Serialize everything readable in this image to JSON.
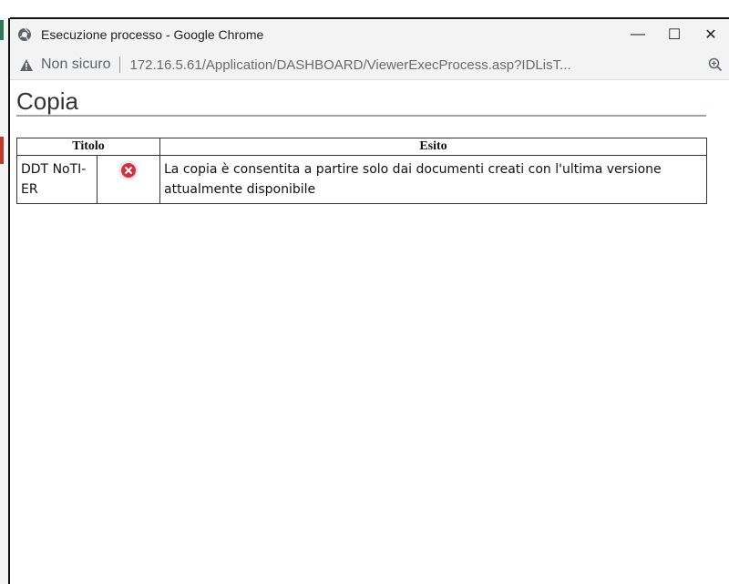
{
  "window": {
    "title": "Esecuzione processo - Google Chrome",
    "minimize_glyph": "—",
    "maximize_glyph": "☐",
    "close_glyph": "✕"
  },
  "addressbar": {
    "security_label": "Non sicuro",
    "url": "172.16.5.61/Application/DASHBOARD/ViewerExecProcess.asp?IDLisT..."
  },
  "page": {
    "title": "Copia"
  },
  "table": {
    "headers": {
      "titolo": "Titolo",
      "esito": "Esito"
    },
    "rows": [
      {
        "titolo": "DDT NoTI-ER",
        "status_icon": "error-icon",
        "esito": "La copia è consentita a partire solo dai documenti creati con l'ultima versione attualmente disponibile"
      }
    ]
  },
  "colors": {
    "error": "#d32f3f",
    "titlebar": "#f3f3f3",
    "rule": "#9ea6aa"
  }
}
